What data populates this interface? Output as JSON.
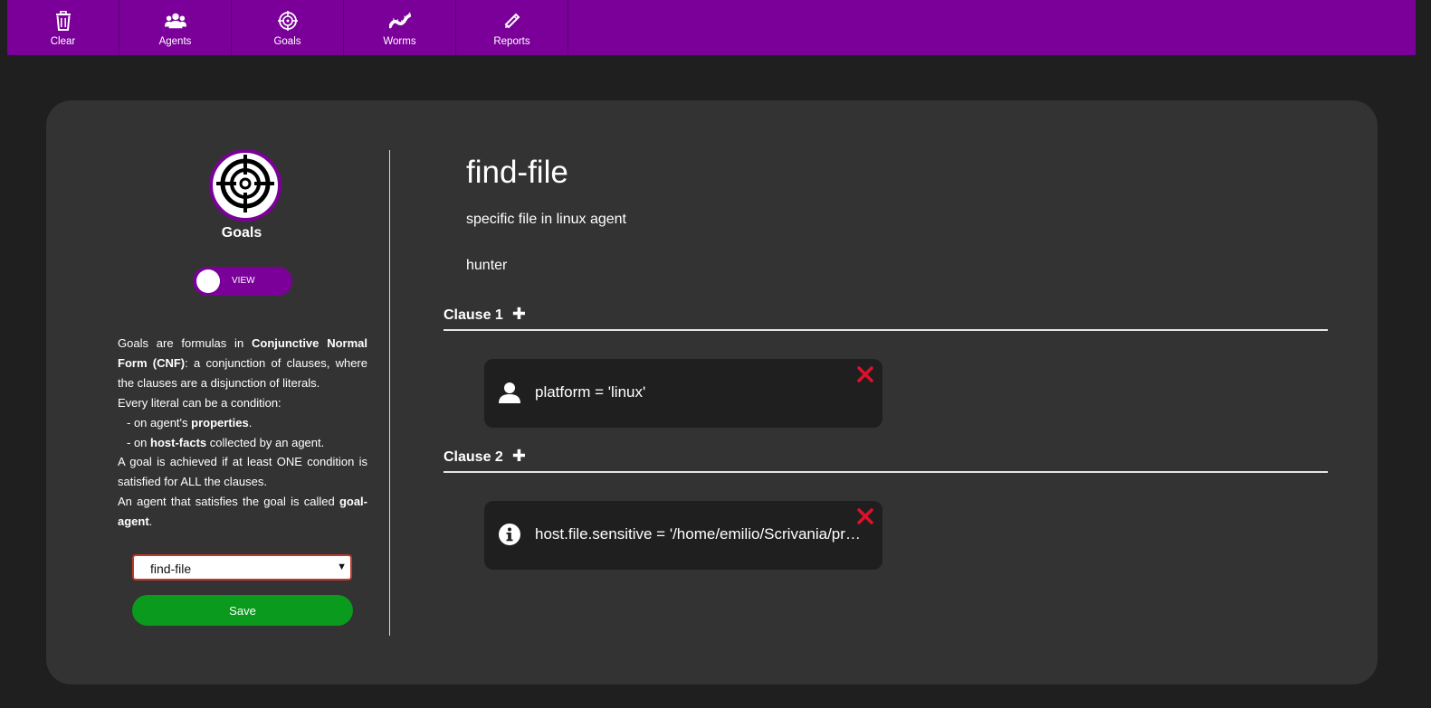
{
  "nav": [
    {
      "label": "Clear",
      "icon": "trash-icon"
    },
    {
      "label": "Agents",
      "icon": "users-icon"
    },
    {
      "label": "Goals",
      "icon": "crosshairs-icon"
    },
    {
      "label": "Worms",
      "icon": "worm-icon"
    },
    {
      "label": "Reports",
      "icon": "pencil-icon"
    }
  ],
  "sidebar": {
    "title": "Goals",
    "toggle_label": "VIEW",
    "description": {
      "p1_a": "Goals are formulas in ",
      "p1_b": "Conjunctive Normal Form (CNF)",
      "p1_c": ": a conjunction of clauses, where the clauses are a disjunction of literals.",
      "p2": "Every literal can be a condition:",
      "p3_a": "- on agent's ",
      "p3_b": "properties",
      "p3_c": ".",
      "p4_a": "- on ",
      "p4_b": "host-facts",
      "p4_c": " collected by an agent.",
      "p5": "A goal is achieved if at least ONE condition is satisfied for ALL the clauses.",
      "p6_a": "An agent that satisfies the goal is called ",
      "p6_b": "goal-agent",
      "p6_c": "."
    },
    "select_value": "find-file",
    "save_label": "Save"
  },
  "goal": {
    "name": "find-file",
    "description": "specific file in linux agent",
    "owner": "hunter"
  },
  "clauses": [
    {
      "label": "Clause 1",
      "literals": [
        {
          "icon": "user-icon",
          "text": "platform = 'linux'"
        }
      ]
    },
    {
      "label": "Clause 2",
      "literals": [
        {
          "icon": "info-icon",
          "text": "host.file.sensitive = '/home/emilio/Scrivania/pr…"
        }
      ]
    }
  ],
  "colors": {
    "accent": "#7b0099",
    "save": "#0a9a1e",
    "delete": "#e0102a",
    "background": "#1f1f1f",
    "card": "#333333"
  }
}
